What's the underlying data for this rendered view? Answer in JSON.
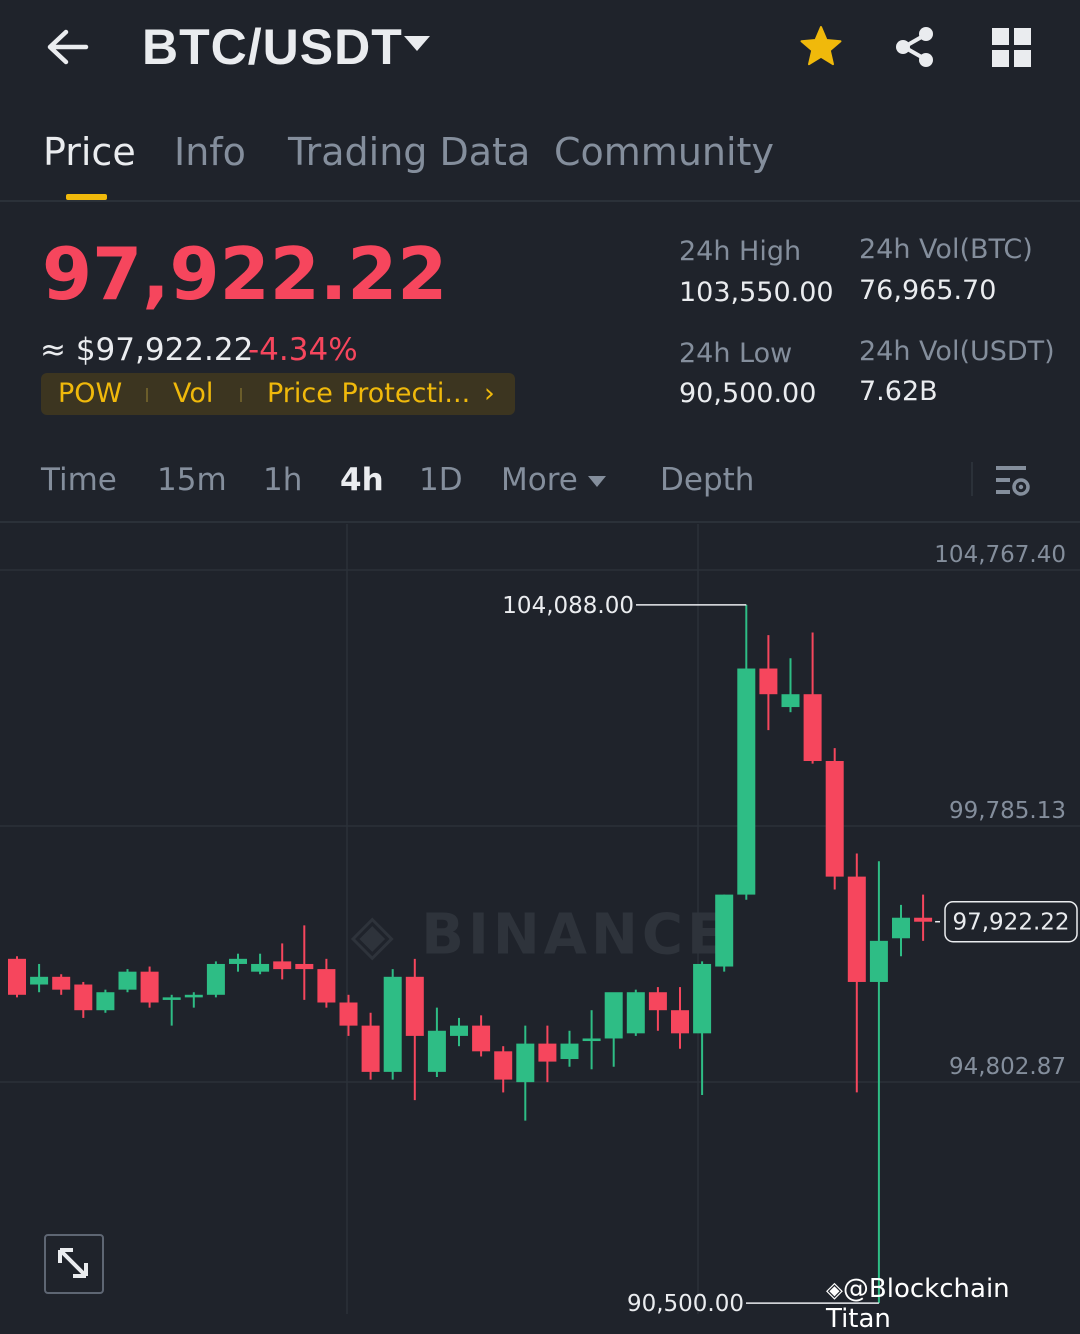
{
  "header": {
    "pair": "BTC/USDT",
    "back_icon": "arrow-left-icon",
    "favorite_icon": "star-icon",
    "share_icon": "share-icon",
    "menu_icon": "grid-icon"
  },
  "tabs": [
    {
      "label": "Price",
      "active": true
    },
    {
      "label": "Info",
      "active": false
    },
    {
      "label": "Trading Data",
      "active": false
    },
    {
      "label": "Community",
      "active": false
    }
  ],
  "price": {
    "last": "97,922.22",
    "usd_equiv": "≈ $97,922.22",
    "change_pct": "-4.34%"
  },
  "tags": [
    "POW",
    "Vol",
    "Price Protecti..."
  ],
  "tags_arrow": "›",
  "stats": {
    "high_label": "24h High",
    "high_value": "103,550.00",
    "low_label": "24h Low",
    "low_value": "90,500.00",
    "vol_btc_label": "24h Vol(BTC)",
    "vol_btc_value": "76,965.70",
    "vol_usdt_label": "24h Vol(USDT)",
    "vol_usdt_value": "7.62B"
  },
  "intervals": [
    "Time",
    "15m",
    "1h",
    "4h",
    "1D",
    "More",
    "Depth"
  ],
  "active_interval": "4h",
  "chart_data": {
    "type": "candlestick",
    "y_axis_labels": [
      "104,767.40",
      "99,785.13",
      "94,802.87"
    ],
    "y_axis_values": [
      104767.4,
      99785.13,
      94802.87
    ],
    "high_marker": "104,088.00",
    "low_marker": "90,500.00",
    "last_price_label": "97,922.22",
    "watermark": "BINANCE",
    "up_color": "#2ebd85",
    "down_color": "#f6465d",
    "candles": [
      [
        97200,
        97250,
        96450,
        96500
      ],
      [
        96700,
        97100,
        96550,
        96850
      ],
      [
        96850,
        96900,
        96500,
        96600
      ],
      [
        96700,
        96750,
        96050,
        96200
      ],
      [
        96200,
        96600,
        96150,
        96550
      ],
      [
        96600,
        97000,
        96550,
        96950
      ],
      [
        96950,
        97050,
        96250,
        96350
      ],
      [
        96400,
        96500,
        95900,
        96450
      ],
      [
        96450,
        96550,
        96250,
        96500
      ],
      [
        96500,
        97150,
        96450,
        97100
      ],
      [
        97100,
        97300,
        96950,
        97200
      ],
      [
        96950,
        97300,
        96900,
        97100
      ],
      [
        97150,
        97500,
        96800,
        97000
      ],
      [
        97100,
        97850,
        96400,
        97000
      ],
      [
        97000,
        97200,
        96250,
        96350
      ],
      [
        96350,
        96500,
        95700,
        95900
      ],
      [
        95900,
        96150,
        94850,
        95000
      ],
      [
        95000,
        97000,
        94850,
        96850
      ],
      [
        96850,
        97200,
        94450,
        95700
      ],
      [
        95000,
        96250,
        94900,
        95800
      ],
      [
        95700,
        96050,
        95500,
        95900
      ],
      [
        95900,
        96100,
        95300,
        95400
      ],
      [
        95400,
        95500,
        94600,
        94850
      ],
      [
        94800,
        95900,
        94050,
        95550
      ],
      [
        95550,
        95900,
        94800,
        95200
      ],
      [
        95250,
        95800,
        95100,
        95550
      ],
      [
        95600,
        96200,
        95050,
        95650
      ],
      [
        95650,
        96400,
        95100,
        96550
      ],
      [
        95750,
        96600,
        95700,
        96550
      ],
      [
        96550,
        96650,
        95800,
        96200
      ],
      [
        96200,
        96650,
        95450,
        95750
      ],
      [
        95750,
        97150,
        94550,
        97100
      ],
      [
        97050,
        98450,
        96950,
        98450
      ],
      [
        98450,
        104088,
        98350,
        102850
      ],
      [
        102850,
        103500,
        101650,
        102350
      ],
      [
        102100,
        103050,
        102000,
        102350
      ],
      [
        102350,
        103550,
        101000,
        101050
      ],
      [
        101050,
        101300,
        98550,
        98800
      ],
      [
        98800,
        99250,
        94600,
        96750
      ],
      [
        96750,
        99100,
        90500,
        97550
      ],
      [
        97600,
        98250,
        97250,
        98000
      ],
      [
        98000,
        98450,
        97550,
        97922.22
      ]
    ]
  },
  "credit": "@Blockchain Titan"
}
